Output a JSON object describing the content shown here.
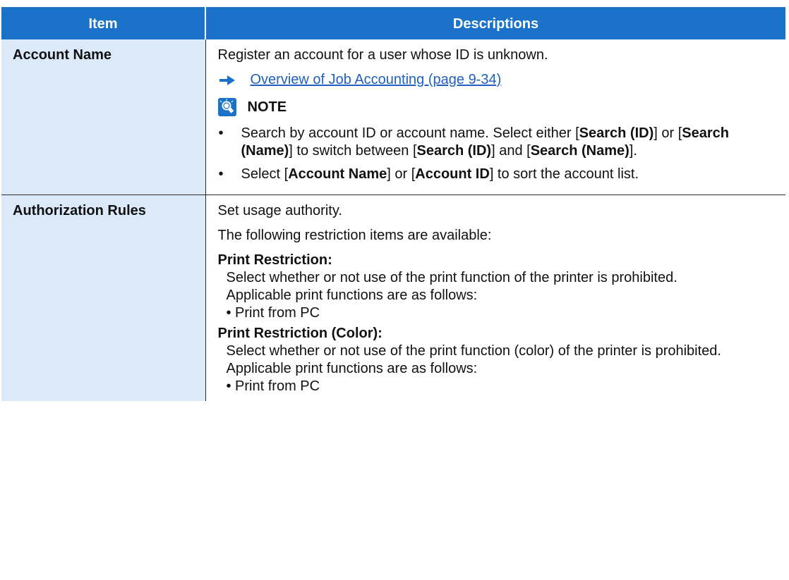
{
  "header": {
    "item": "Item",
    "descriptions": "Descriptions"
  },
  "rows": {
    "account": {
      "label": "Account Name",
      "intro": "Register an account for a user whose ID is unknown.",
      "link": "Overview of Job Accounting (page 9-34)",
      "note_title": "NOTE",
      "b1": {
        "t1": "Search by account ID or account name. Select either [",
        "k1": "Search (ID)",
        "t2": "] or [",
        "k2": "Search (Name)",
        "t3": "] to switch between [",
        "k3": "Search (ID)",
        "t4": "] and [",
        "k4": "Search (Name)",
        "t5": "]."
      },
      "b2": {
        "t1": "Select [",
        "k1": "Account Name",
        "t2": "] or [",
        "k2": "Account ID",
        "t3": "] to sort the account list."
      }
    },
    "auth": {
      "label": "Authorization Rules",
      "l1": "Set usage authority.",
      "l2": "The following restriction items are available:",
      "print": {
        "head": "Print Restriction",
        "colon": ":",
        "d1": "Select whether or not use of the print function of the printer is prohibited.",
        "d2": "Applicable print functions are as follows:",
        "d3": "• Print from PC"
      },
      "color": {
        "head": "Print Restriction (Color)",
        "colon": ":",
        "d1": "Select whether or not use of the print function (color) of the printer is prohibited.",
        "d2": "Applicable print functions are as follows:",
        "d3": "• Print from PC"
      }
    }
  },
  "bullet": "•",
  "icons": {
    "arrow": "arrow-right-icon",
    "note": "lightbulb-note-icon"
  },
  "colors": {
    "header_bg": "#1a73c9",
    "item_bg": "#dce9f8",
    "link": "#1f5fbf"
  }
}
